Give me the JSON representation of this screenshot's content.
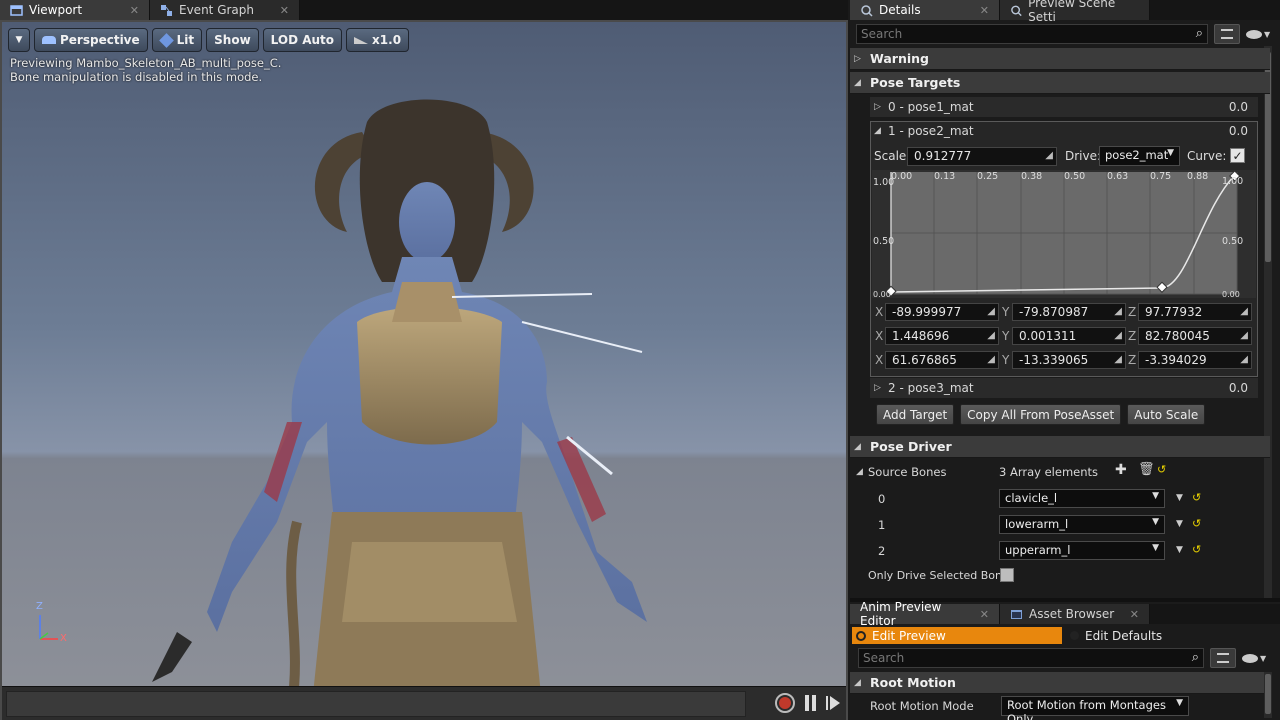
{
  "viewport_tabs": [
    {
      "label": "Viewport",
      "icon": "viewport-icon"
    },
    {
      "label": "Event Graph",
      "icon": "graph-icon"
    }
  ],
  "viewport_toolbar": {
    "perspective": "Perspective",
    "lit": "Lit",
    "show": "Show",
    "lod": "LOD Auto",
    "speed": "x1.0"
  },
  "viewport_info": {
    "line1": "Previewing Mambo_Skeleton_AB_multi_pose_C.",
    "line2": "Bone manipulation is disabled in this mode."
  },
  "axis": {
    "z": "Z",
    "x": "X"
  },
  "details_tabs": [
    {
      "label": "Details",
      "icon": "details-icon"
    },
    {
      "label": "Preview Scene Setti",
      "icon": "preview-scene-icon"
    }
  ],
  "details": {
    "search_placeholder": "Search",
    "warning_label": "Warning",
    "pose_targets_label": "Pose Targets",
    "targets": [
      {
        "label": "0 - pose1_mat",
        "value": "0.0"
      },
      {
        "label": "1 - pose2_mat",
        "value": "0.0"
      },
      {
        "label": "2 - pose3_mat",
        "value": "0.0"
      }
    ],
    "scale_label": "Scale:",
    "scale_value": "0.912777",
    "drive_label": "Drive:",
    "drive_value": "pose2_mat",
    "curve_label": "Curve:",
    "curve_checked": true,
    "curve_x_ticks": [
      "0.00",
      "0.13",
      "0.25",
      "0.38",
      "0.50",
      "0.63",
      "0.75",
      "0.88",
      "1.00"
    ],
    "curve_y_left": [
      "1.00",
      "0.50",
      "0.00"
    ],
    "curve_y_right": [
      "1.00",
      "0.50",
      "0.00"
    ],
    "vector_rows": [
      {
        "x": "-89.999977",
        "y": "-79.870987",
        "z": "97.77932"
      },
      {
        "x": "1.448696",
        "y": "0.001311",
        "z": "82.780045"
      },
      {
        "x": "61.676865",
        "y": "-13.339065",
        "z": "-3.394029"
      }
    ],
    "axis_labels": {
      "x": "X",
      "y": "Y",
      "z": "Z"
    },
    "buttons": {
      "add_target": "Add Target",
      "copy_all": "Copy All From PoseAsset",
      "auto_scale": "Auto Scale"
    },
    "pose_driver_label": "Pose Driver",
    "source_bones_label": "Source Bones",
    "source_bones_count": "3 Array elements",
    "bones": [
      {
        "index": "0",
        "name": "clavicle_l"
      },
      {
        "index": "1",
        "name": "lowerarm_l"
      },
      {
        "index": "2",
        "name": "upperarm_l"
      }
    ],
    "only_drive_label": "Only Drive Selected Bone"
  },
  "bottom_tabs": [
    {
      "label": "Anim Preview Editor",
      "icon": ""
    },
    {
      "label": "Asset Browser",
      "icon": "asset-browser-icon"
    }
  ],
  "anim_preview": {
    "edit_preview": "Edit Preview",
    "edit_defaults": "Edit Defaults",
    "search_placeholder": "Search",
    "root_motion_label": "Root Motion",
    "root_motion_mode_label": "Root Motion Mode",
    "root_motion_mode_value": "Root Motion from Montages Only"
  },
  "colors": {
    "accent_orange": "#e8870d",
    "record_red": "#c0392b",
    "curve_bg": "#6a6a6a"
  }
}
